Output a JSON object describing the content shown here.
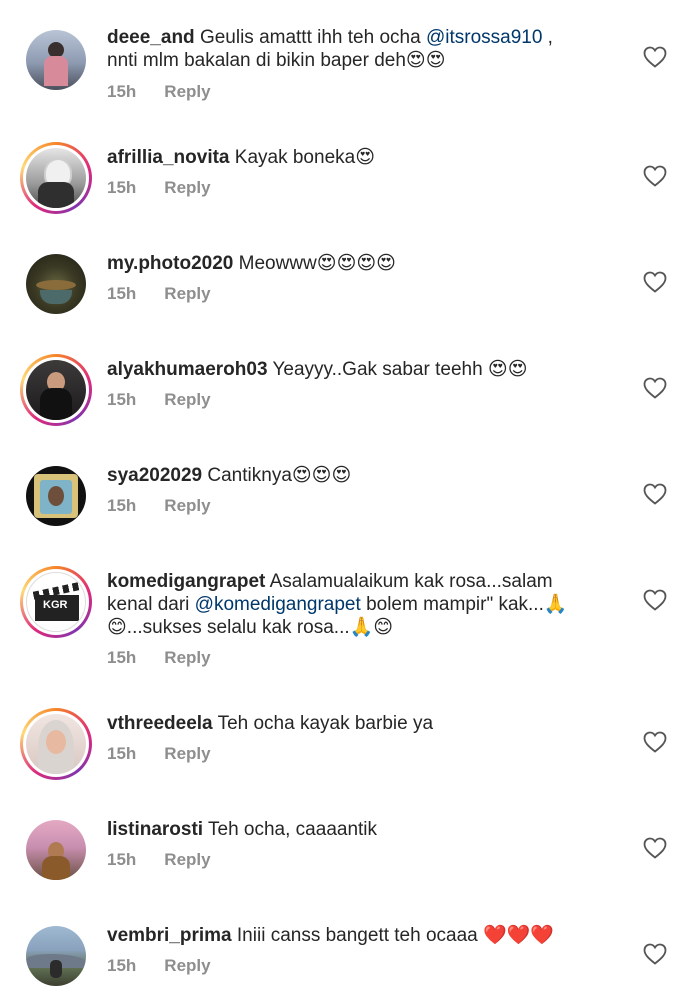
{
  "comments": [
    {
      "username": "deee_and",
      "pre": "Geulis amattt ihh teh ocha ",
      "mention": "@itsrossa910",
      "post": " , nnti mlm bakalan di bikin baper deh😍😍",
      "time": "15h",
      "reply": "Reply"
    },
    {
      "username": "afrillia_novita",
      "pre": "Kayak boneka😍",
      "mention": "",
      "post": "",
      "time": "15h",
      "reply": "Reply"
    },
    {
      "username": "my.photo2020",
      "pre": "Meowww😍😍😍😍",
      "mention": "",
      "post": "",
      "time": "15h",
      "reply": "Reply"
    },
    {
      "username": "alyakhumaeroh03",
      "pre": "Yeayyy..Gak sabar teehh 😍😍",
      "mention": "",
      "post": "",
      "time": "15h",
      "reply": "Reply"
    },
    {
      "username": "sya202029",
      "pre": "Cantiknya😍😍😍",
      "mention": "",
      "post": "",
      "time": "15h",
      "reply": "Reply"
    },
    {
      "username": "komedigangrapet",
      "pre": "Asalamualaikum kak rosa...salam kenal dari ",
      "mention": "@komedigangrapet",
      "post": " bolem mampir\" kak...🙏 😊...sukses selalu kak rosa...🙏😊",
      "time": "15h",
      "reply": "Reply"
    },
    {
      "username": "vthreedeela",
      "pre": "Teh ocha kayak barbie ya",
      "mention": "",
      "post": "",
      "time": "15h",
      "reply": "Reply"
    },
    {
      "username": "listinarosti",
      "pre": "Teh ocha, caaaantik",
      "mention": "",
      "post": "",
      "time": "15h",
      "reply": "Reply"
    },
    {
      "username": "vembri_prima",
      "pre": "Iniii canss bangett teh ocaaa ❤️❤️❤️",
      "mention": "",
      "post": "",
      "time": "15h",
      "reply": "Reply"
    }
  ],
  "colors": {
    "mention": "#00376b",
    "meta": "#8e8e8e",
    "text": "#262626",
    "story_ring": "#dd2a7b"
  },
  "icons": {
    "like": "heart-outline-icon"
  }
}
